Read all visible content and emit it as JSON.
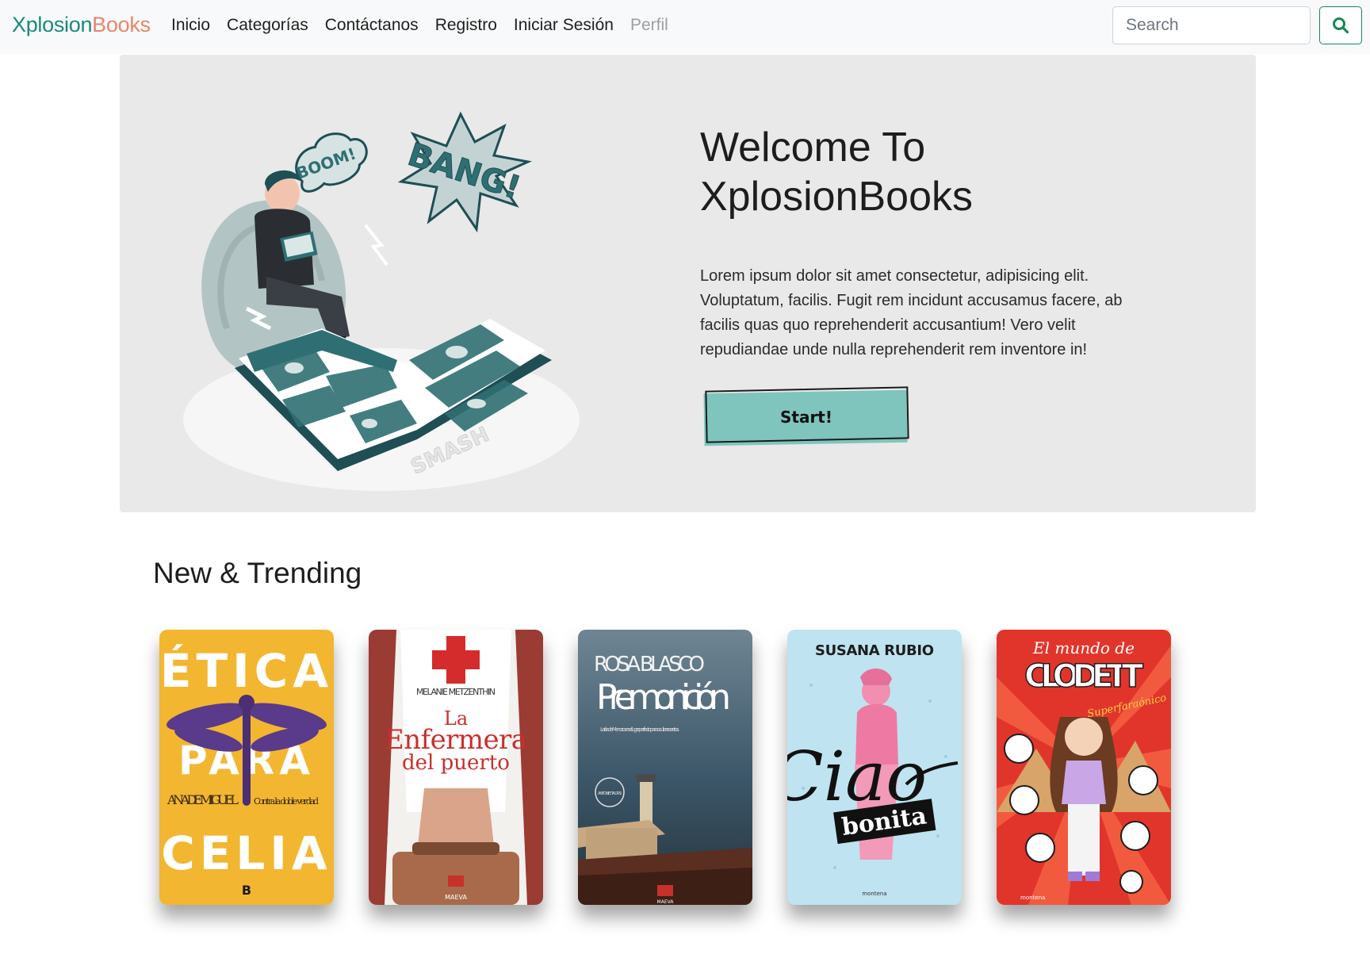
{
  "navbar": {
    "brand_part1": "Xplosion",
    "brand_part2": "Books",
    "links": [
      "Inicio",
      "Categorías",
      "Contáctanos",
      "Registro",
      "Iniciar Sesión",
      "Perfil"
    ],
    "search_placeholder": "Search",
    "search_icon": "search-icon"
  },
  "hero": {
    "title": "Welcome To XplosionBooks",
    "text": "Lorem ipsum dolor sit amet consectetur, adipisicing elit. Voluptatum, facilis. Fugit rem incidunt accusamus facere, ab facilis quas quo reprehenderit accusantium! Vero velit repudiandae unde nulla reprehenderit rem inventore in!",
    "button_label": "Start!",
    "illustration_words": [
      "BOOM!",
      "BANG!",
      "SMASH"
    ]
  },
  "trending": {
    "title": "New & Trending",
    "books": [
      {
        "title_top": "ÉTICA",
        "title_mid": "PARA",
        "title_bottom": "CELIA",
        "author": "ANA DE MIGUEL",
        "subtitle": "Contra la doble verdad",
        "publisher": "B"
      },
      {
        "author": "MELANIE METZENTHIN",
        "title_line1": "La",
        "title_line2": "Enfermera",
        "title_line3": "del puerto",
        "publisher": "MAEVA"
      },
      {
        "author": "ROSA BLASCO",
        "title": "Premonición",
        "tagline": "La isla de Menorca es el lugar perfecto para ocultar secretos.",
        "badge": "ANTONIETTA ORSI",
        "publisher": "MAEVA"
      },
      {
        "author": "SUSANA RUBIO",
        "title_script": "Ciao",
        "title_block": "bonita",
        "publisher": "montena"
      },
      {
        "title_script": "El mundo de",
        "title": "CLODETT",
        "subtitle": "Superfaraónico",
        "publisher": "montena"
      }
    ]
  },
  "colors": {
    "brand_teal": "#1a8a7a",
    "brand_coral": "#e8866b",
    "hero_bg": "#e8e9e8",
    "start_button": "#7fc4bd",
    "search_green": "#198754"
  }
}
